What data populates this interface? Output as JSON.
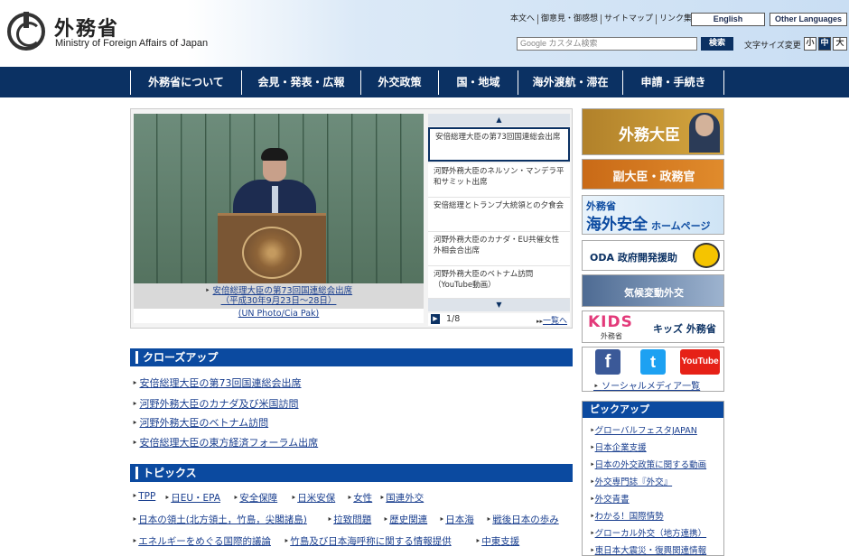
{
  "header": {
    "logo_ja": "外務省",
    "logo_en": "Ministry of Foreign Affairs of Japan",
    "util_links": [
      "本文へ",
      "御意見・御感想",
      "サイトマップ",
      "リンク集"
    ],
    "lang_english": "English",
    "lang_other": "Other Languages",
    "search_placeholder": "Google カスタム検索",
    "search_button": "検索",
    "fontsize_label": "文字サイズ変更",
    "fontsize_options": [
      "小",
      "中",
      "大"
    ]
  },
  "nav": [
    "外務省について",
    "会見・発表・広報",
    "外交政策",
    "国・地域",
    "海外渡航・滞在",
    "申請・手続き"
  ],
  "carousel": {
    "caption_line1": "安倍総理大臣の第73回国連総会出席",
    "caption_line2": "（平成30年9月23日～28日）",
    "caption_credit": "(UN Photo/Cia Pak)",
    "items": [
      "安倍総理大臣の第73回国連総会出席",
      "河野外務大臣のネルソン・マンデラ平和サミット出席",
      "安倍総理とトランプ大統領との夕食会",
      "河野外務大臣のカナダ・EU共催女性外相会合出席",
      "河野外務大臣のベトナム訪問（YouTube動画）"
    ],
    "pager": "1/8",
    "list_all": "一覧へ"
  },
  "closeup": {
    "title": "クローズアップ",
    "items": [
      "安倍総理大臣の第73回国連総会出席",
      "河野外務大臣のカナダ及び米国訪問",
      "河野外務大臣のベトナム訪問",
      "安倍総理大臣の東方経済フォーラム出席"
    ]
  },
  "topics": {
    "title": "トピックス",
    "row1": [
      "TPP",
      "日EU・EPA",
      "安全保障",
      "日米安保",
      "女性",
      "国連外交"
    ],
    "row2": [
      "日本の領土(北方領土，竹島，尖閣諸島)",
      "拉致問題",
      "歴史関連",
      "日本海",
      "戦後日本の歩み"
    ],
    "row3": [
      "エネルギーをめぐる国際的議論",
      "竹島及び日本海呼称に関する情報提供",
      "中東支援"
    ]
  },
  "sidebar": {
    "minister": "外務大臣",
    "vice": "副大臣・政務官",
    "safety_1": "外務省",
    "safety_2": "海外安全",
    "safety_3": "ホームページ",
    "oda": "ODA 政府開発援助",
    "climate": "気候変動外交",
    "kids_logo": "KIDS",
    "kids_sub": "外務省",
    "kids": "キッズ 外務省",
    "social_fb": "f",
    "social_tw": "t",
    "social_yt": "YouTube",
    "social_link": "ソーシャルメディア一覧",
    "pickup_title": "ピックアップ",
    "pickup": [
      "グローバルフェスタJAPAN",
      "日本企業支援",
      "日本の外交政策に関する動画",
      "外交専門誌『外交』",
      "外交青書",
      "わかる！国際情勢",
      "グローカル外交（地方連携）",
      "東日本大震災・復興関連情報"
    ]
  }
}
